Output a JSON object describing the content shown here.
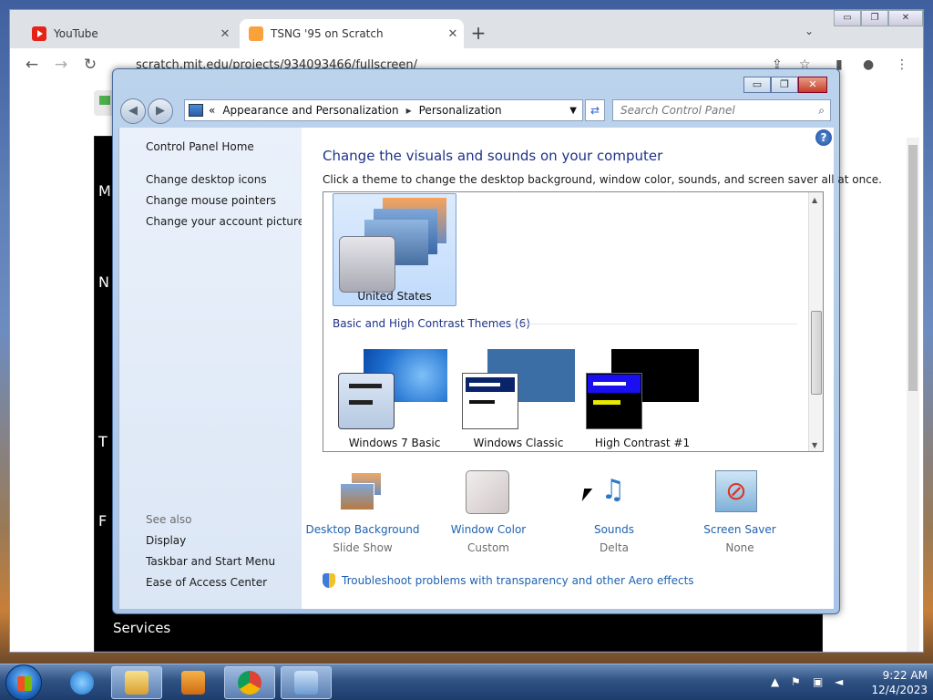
{
  "browser": {
    "tabs": [
      {
        "title": "YouTube",
        "icon": "youtube-icon"
      },
      {
        "title": "TSNG '95 on Scratch",
        "icon": "scratch-icon"
      }
    ],
    "new_tab": "+",
    "tab_search": "⌄",
    "url": "scratch.mit.edu/projects/934093466/fullscreen/",
    "nav": {
      "back": "←",
      "forward": "→",
      "reload": "↻"
    },
    "stage_letters": [
      "M",
      "N",
      "T",
      "F"
    ],
    "stage_bottom_text": "Services"
  },
  "control_panel": {
    "title_buttons": {
      "minimize": "▭",
      "maximize": "❐",
      "close": "✕"
    },
    "breadcrumb": {
      "prefix": "«",
      "part1": "Appearance and Personalization",
      "separator": "▸",
      "part2": "Personalization"
    },
    "search_placeholder": "Search Control Panel",
    "sidebar": {
      "home": "Control Panel Home",
      "links": [
        "Change desktop icons",
        "Change mouse pointers",
        "Change your account picture"
      ],
      "see_also_heading": "See also",
      "see_also": [
        "Display",
        "Taskbar and Start Menu",
        "Ease of Access Center"
      ]
    },
    "main": {
      "help": "?",
      "heading": "Change the visuals and sounds on your computer",
      "subheading": "Click a theme to change the desktop background, window color, sounds, and screen saver all at once.",
      "selected_theme": "United States",
      "group_heading": "Basic and High Contrast Themes (6)",
      "themes": [
        "Windows 7 Basic",
        "Windows Classic",
        "High Contrast #1"
      ],
      "bottom_items": [
        {
          "label": "Desktop Background",
          "value": "Slide Show"
        },
        {
          "label": "Window Color",
          "value": "Custom"
        },
        {
          "label": "Sounds",
          "value": "Delta"
        },
        {
          "label": "Screen Saver",
          "value": "None"
        }
      ],
      "troubleshoot": "Troubleshoot problems with transparency and other Aero effects"
    }
  },
  "taskbar": {
    "time": "9:22 AM",
    "date": "12/4/2023",
    "tray_arrow": "▲"
  },
  "colors": {
    "link": "#1e62b0",
    "heading": "#1e3287",
    "selected": "#c1dbfc"
  }
}
